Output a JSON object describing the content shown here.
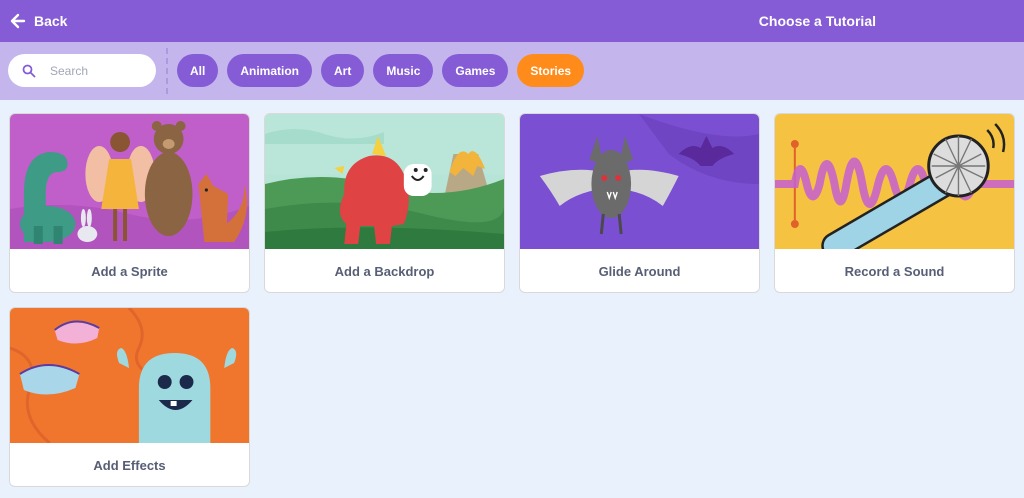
{
  "header": {
    "back_label": "Back",
    "title": "Choose a Tutorial"
  },
  "search": {
    "placeholder": "Search"
  },
  "filters": [
    {
      "label": "All",
      "active": false
    },
    {
      "label": "Animation",
      "active": false
    },
    {
      "label": "Art",
      "active": false
    },
    {
      "label": "Music",
      "active": false
    },
    {
      "label": "Games",
      "active": false
    },
    {
      "label": "Stories",
      "active": true
    }
  ],
  "cards": [
    {
      "label": "Add a Sprite"
    },
    {
      "label": "Add a Backdrop"
    },
    {
      "label": "Glide Around"
    },
    {
      "label": "Record a Sound"
    },
    {
      "label": "Add Effects"
    }
  ],
  "colors": {
    "header": "#855cd6",
    "filterbar": "#c4b6ed",
    "active_tag": "#ff8c1a",
    "page_bg": "#e9f1fc"
  }
}
